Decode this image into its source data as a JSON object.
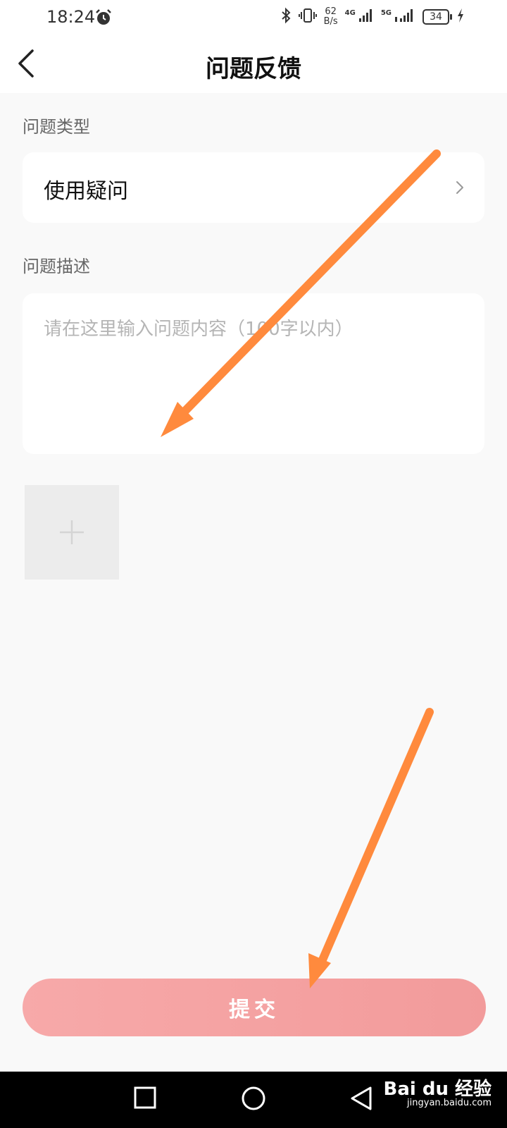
{
  "status_bar": {
    "time": "18:24",
    "net_speed_value": "62",
    "net_speed_unit": "B/s",
    "network_1": "4G",
    "network_2": "5G",
    "battery": "34"
  },
  "header": {
    "title": "问题反馈"
  },
  "form": {
    "type_label": "问题类型",
    "type_value": "使用疑问",
    "description_label": "问题描述",
    "description_placeholder": "请在这里输入问题内容（100字以内）",
    "description_value": ""
  },
  "submit": {
    "label": "提交"
  },
  "watermark": {
    "brand": "Bai du 经验",
    "url": "jingyan.baidu.com"
  },
  "colors": {
    "accent": "#F29B9B",
    "arrow": "#FF8A3D"
  }
}
